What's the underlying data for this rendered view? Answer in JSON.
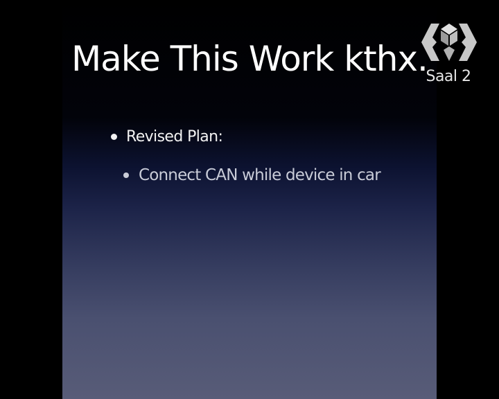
{
  "slide": {
    "title": "Make This Work kthx.",
    "bullets": [
      {
        "text": "Revised Plan:",
        "level": 1
      },
      {
        "text": "Connect CAN while device in car",
        "level": 2
      }
    ]
  },
  "overlay": {
    "logo_icon": "ccc-cube-logo-icon",
    "room_label": "Saal 2"
  },
  "colors": {
    "background": "#000000",
    "slide_gradient_bottom": "#585c78",
    "title_text": "#ffffff",
    "bullet_text": "#f2f2f2",
    "sub_bullet_text": "#c9ccd8",
    "logo": "#d0d0d0"
  }
}
